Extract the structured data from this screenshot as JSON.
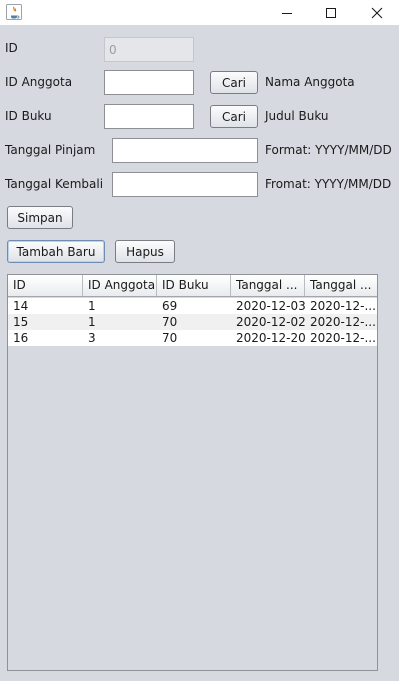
{
  "window": {
    "icon": "java-icon",
    "controls": [
      "minimize-icon",
      "maximize-icon",
      "close-icon"
    ]
  },
  "form": {
    "id_label": "ID",
    "id_value": "0",
    "anggota_label": "ID Anggota",
    "anggota_value": "",
    "cari_label": "Cari",
    "nama_anggota_label": "Nama Anggota",
    "buku_label": "ID Buku",
    "buku_value": "",
    "judul_buku_label": "Judul Buku",
    "pinjam_label": "Tanggal Pinjam",
    "pinjam_value": "",
    "pinjam_format": "Format: YYYY/MM/DD",
    "kembali_label": "Tanggal Kembali",
    "kembali_value": "",
    "kembali_format": "Fromat: YYYY/MM/DD"
  },
  "buttons": {
    "simpan": "Simpan",
    "tambah_baru": "Tambah Baru",
    "hapus": "Hapus"
  },
  "table": {
    "columns": [
      "ID",
      "ID Anggota",
      "ID Buku",
      "Tanggal ...",
      "Tanggal ..."
    ],
    "rows": [
      [
        "14",
        "1",
        "69",
        "2020-12-03",
        "2020-12-..."
      ],
      [
        "15",
        "1",
        "70",
        "2020-12-02",
        "2020-12-..."
      ],
      [
        "16",
        "3",
        "70",
        "2020-12-20",
        "2020-12-..."
      ]
    ]
  },
  "colors": {
    "panel_bg": "#d6d9df",
    "row_alt": "#f0f0f0",
    "row_bg": "#ffffff"
  }
}
